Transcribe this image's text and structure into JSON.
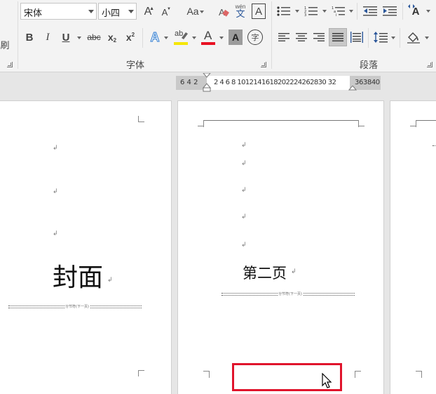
{
  "ribbon": {
    "format_painter_partial": "刷",
    "font": {
      "name": "宋体",
      "size": "小四",
      "grow_label": "A",
      "shrink_label": "A",
      "case_label": "Aa",
      "phonetic_top": "wén",
      "phonetic_bottom": "文",
      "border_char_label": "A",
      "bold": "B",
      "italic": "I",
      "underline": "U",
      "strike": "abc",
      "subscript": "x",
      "subscript_mark": "2",
      "superscript": "x",
      "superscript_mark": "2",
      "text_effect": "A",
      "highlight": "ab",
      "font_color": "A",
      "char_shading": "A",
      "enclose": "字",
      "group_label": "字体",
      "highlight_color": "#f5e600",
      "font_color_value": "#e81123"
    },
    "paragraph": {
      "group_label": "段落",
      "style_label": "A"
    }
  },
  "ruler": {
    "left_numbers": "6 4 2",
    "right_numbers": "2 4 6 8 1012141618202224262830 32",
    "tail_numbers": "363840"
  },
  "pages": {
    "page1": {
      "para_mark": "↲",
      "title": "封面",
      "section_break": "分节符(下一页)"
    },
    "page2": {
      "para_mark": "↲",
      "title": "第二页",
      "section_break": "分节符(下一页)"
    }
  },
  "colors": {
    "highlight_box": "#e0142c"
  }
}
